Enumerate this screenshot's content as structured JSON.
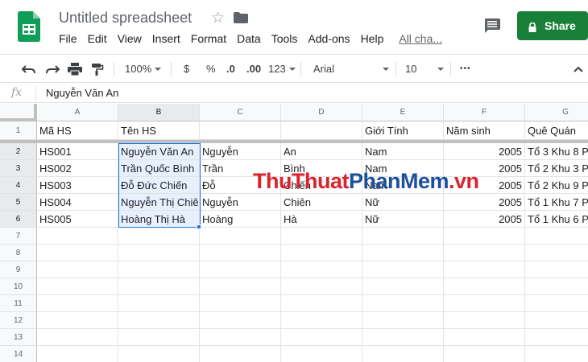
{
  "header": {
    "doc_title": "Untitled spreadsheet",
    "menu": [
      "File",
      "Edit",
      "View",
      "Insert",
      "Format",
      "Data",
      "Tools",
      "Add-ons",
      "Help"
    ],
    "last_edit": "All cha...",
    "share_label": "Share"
  },
  "toolbar": {
    "zoom": "100%",
    "currency": "$",
    "percent": "%",
    "decrease_decimals": ".0",
    "increase_decimals": ".00",
    "more_formats": "123",
    "font": "Arial",
    "font_size": "10",
    "more": "•••"
  },
  "formula_bar": {
    "fx": "fx",
    "content": "Nguyễn Văn An"
  },
  "grid": {
    "columns": [
      "A",
      "B",
      "C",
      "D",
      "E",
      "F",
      "G"
    ],
    "rows": [
      "1",
      "2",
      "3",
      "4",
      "5",
      "6",
      "7",
      "8",
      "9",
      "10",
      "11",
      "12",
      "13",
      "14"
    ],
    "cells": [
      [
        "Mã HS",
        "Tên HS",
        "",
        "",
        "Giới Tính",
        "Năm sinh",
        "Quê Quán"
      ],
      [
        "HS001",
        "Nguyễn Văn An",
        "Nguyễn",
        "An",
        "Nam",
        "2005",
        "Tổ 3 Khu 8 P"
      ],
      [
        "HS002",
        "Trần Quốc Bình",
        "Trần",
        "Bình",
        "Nam",
        "2005",
        "Tổ 2 Khu 3 P"
      ],
      [
        "HS003",
        "Đỗ Đức Chiến",
        "Đỗ",
        "Chiến",
        "Nam",
        "2005",
        "Tổ 2 Khu 9 P"
      ],
      [
        "HS004",
        "Nguyễn Thị Chiên",
        "Nguyễn",
        "Chiên",
        "Nữ",
        "2005",
        "Tổ 1 Khu 7 P"
      ],
      [
        "HS005",
        "Hoàng Thị Hà",
        "Hoàng",
        "Hà",
        "Nữ",
        "2005",
        "Tổ 1 Khu 6 P"
      ]
    ],
    "selected_column": "B",
    "selected_rows": [
      "2",
      "3",
      "4",
      "5",
      "6"
    ]
  },
  "watermark": {
    "part1": "ThuThuat",
    "part2": "PhanMem",
    "part3": ".vn"
  },
  "colors": {
    "share_green": "#188038",
    "selection_blue": "#1a73e8"
  }
}
